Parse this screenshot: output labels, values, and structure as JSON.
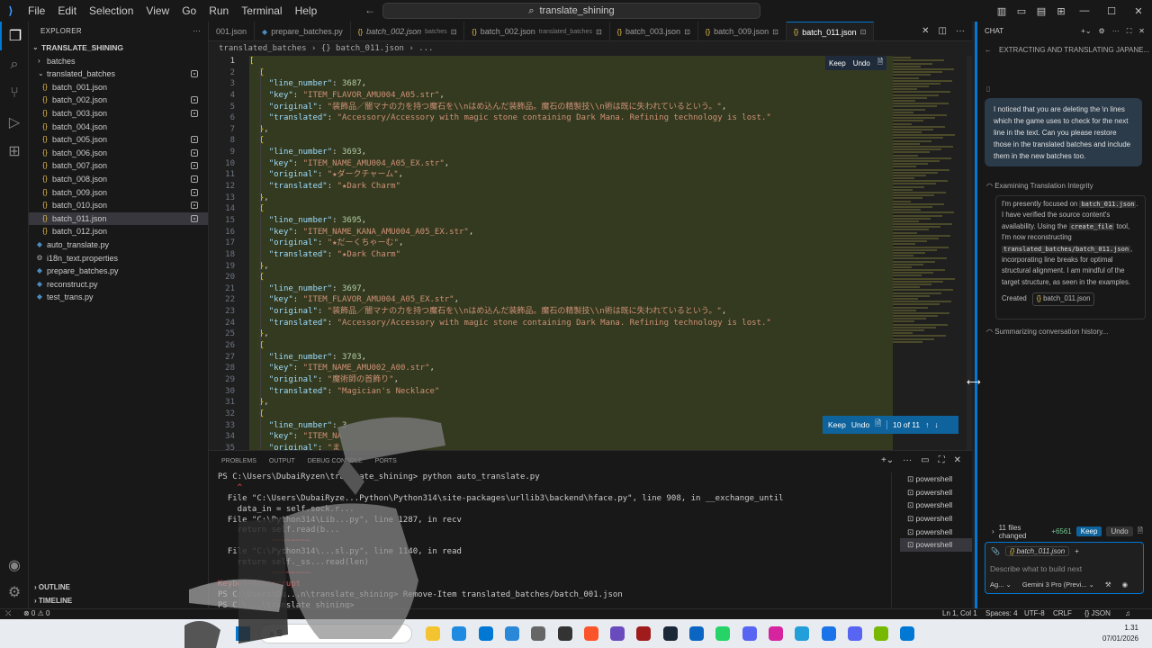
{
  "menu": [
    "File",
    "Edit",
    "Selection",
    "View",
    "Go",
    "Run",
    "Terminal",
    "Help"
  ],
  "search": {
    "label": "translate_shining"
  },
  "sidebar": {
    "title": "EXPLORER",
    "project": "TRANSLATE_SHINING",
    "folders": [
      "batches",
      "translated_batches"
    ],
    "files": [
      "batch_001.json",
      "batch_002.json",
      "batch_003.json",
      "batch_004.json",
      "batch_005.json",
      "batch_006.json",
      "batch_007.json",
      "batch_008.json",
      "batch_009.json",
      "batch_010.json",
      "batch_011.json",
      "batch_012.json"
    ],
    "root_files": [
      "auto_translate.py",
      "i18n_text.properties",
      "prepare_batches.py",
      "reconstruct.py",
      "test_trans.py"
    ],
    "outline": "OUTLINE",
    "timeline": "TIMELINE"
  },
  "tabs": [
    {
      "label": "001.json",
      "sub": ""
    },
    {
      "label": "prepare_batches.py",
      "sub": ""
    },
    {
      "label": "batch_002.json",
      "sub": "batches"
    },
    {
      "label": "batch_002.json",
      "sub": "translated_batches"
    },
    {
      "label": "batch_003.json",
      "sub": ""
    },
    {
      "label": "batch_009.json",
      "sub": ""
    },
    {
      "label": "batch_011.json",
      "sub": ""
    }
  ],
  "breadcrumb": "translated_batches  ›  {} batch_011.json  › ...",
  "keep_bar": {
    "keep": "Keep",
    "undo": "Undo",
    "counter": "10 of 11"
  },
  "code_lines": [
    "[",
    "  {",
    "    \"line_number\": 3687,",
    "    \"key\": \"ITEM_FLAVOR_AMU004_A05.str\",",
    "    \"original\": \"装飾品／闇マナの力を持つ魔石を\\\\nはめ込んだ装飾品。魔石の精製技\\\\n術は既に失われているという。\",",
    "    \"translated\": \"Accessory/Accessory with magic stone containing Dark Mana. Refining technology is lost.\"",
    "  },",
    "  {",
    "    \"line_number\": 3693,",
    "    \"key\": \"ITEM_NAME_AMU004_A05_EX.str\",",
    "    \"original\": \"★ダークチャーム\",",
    "    \"translated\": \"★Dark Charm\"",
    "  },",
    "  {",
    "    \"line_number\": 3695,",
    "    \"key\": \"ITEM_NAME_KANA_AMU004_A05_EX.str\",",
    "    \"original\": \"★だーくちゃーむ\",",
    "    \"translated\": \"★Dark Charm\"",
    "  },",
    "  {",
    "    \"line_number\": 3697,",
    "    \"key\": \"ITEM_FLAVOR_AMU004_A05_EX.str\",",
    "    \"original\": \"装飾品／闇マナの力を持つ魔石を\\\\nはめ込んだ装飾品。魔石の精製技\\\\n術は既に失われているという。\",",
    "    \"translated\": \"Accessory/Accessory with magic stone containing Dark Mana. Refining technology is lost.\"",
    "  },",
    "  {",
    "    \"line_number\": 3703,",
    "    \"key\": \"ITEM_NAME_AMU002_A00.str\",",
    "    \"original\": \"魔術師の首飾り\",",
    "    \"translated\": \"Magician's Necklace\"",
    "  },",
    "  {",
    "    \"line_number\": 3",
    "    \"key\": \"ITEM_NA",
    "    \"original\": \"ま"
  ],
  "panel": {
    "tabs": [
      "PROBLEMS",
      "OUTPUT",
      "DEBUG CONSOLE",
      "PORTS"
    ]
  },
  "terminal_lines": [
    "PS C:\\Users\\DubaiRyzen\\translate_shining> python auto_translate.py",
    "    ^",
    "  File \"C:\\Users\\DubaiRyze...Python\\Python314\\site-packages\\urllib3\\backend\\hface.py\", line 908, in __exchange_until",
    "    data_in = self.sock.r...",
    "  File \"C:\\Python314\\Lib...py\", line 1287, in recv",
    "    return self.read(b...",
    "           ~~~~~~~~",
    "  File \"C:\\Python314\\...sl.py\", line 1140, in read",
    "    return self._ss...read(len)",
    "           ~~~~~~~~",
    "KeyboardInterrupt",
    "PS C:\\Users\\Du...n\\translate_shining> Remove-Item translated_batches/batch_001.json",
    "PS C:\\...\\translate_shining> "
  ],
  "terminals": [
    "powershell",
    "powershell",
    "powershell",
    "powershell",
    "powershell",
    "powershell"
  ],
  "chat": {
    "header": "CHAT",
    "title": "EXTRACTING AND TRANSLATING JAPANE...",
    "user_message": "I noticed that you are deleting the \\n lines which the game uses to check for the next line in the text. Can you please restore those in the translated batches and include them in the new batches too.",
    "thinking_title": "Examining Translation Integrity",
    "thinking_1": "I'm presently focused on",
    "chip_1": "batch_011.json",
    "thinking_2": ". I have verified the source content's availability. Using the",
    "chip_2": "create_file",
    "thinking_3": "tool, I'm now reconstructing",
    "chip_3": "translated_batches/batch_011.json",
    "thinking_4": ", incorporating line breaks for optimal structural alignment. I am mindful of the target structure, as seen in the examples.",
    "created_label": "Created",
    "created_file": "batch_011.json",
    "summarizing": "Summarizing conversation history...",
    "files_changed": "11 files changed",
    "additions": "+6561",
    "keep": "Keep",
    "undo": "Undo",
    "attachment": "batch_011.json",
    "placeholder": "Describe what to build next",
    "mode": "Ag...",
    "model": "Gemini 3 Pro (Previ..."
  },
  "status": {
    "left": "⊗ 0  ⚠ 0",
    "position": "Ln 1, Col 1",
    "spaces": "Spaces: 4",
    "encoding": "UTF-8",
    "eol": "CRLF",
    "language": "{} JSON"
  },
  "taskbar": {
    "time": "1.31",
    "date": "07/01/2026",
    "search": "S"
  },
  "colors": {
    "accent": "#0078d4",
    "diff_bg": "#343a1f"
  }
}
